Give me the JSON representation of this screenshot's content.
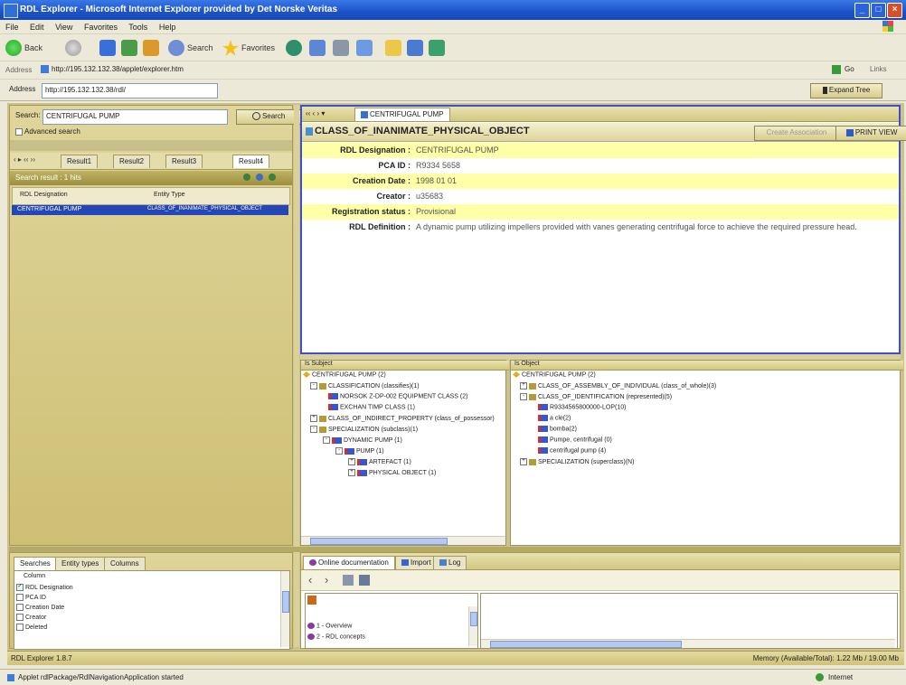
{
  "window": {
    "title": "RDL Explorer - Microsoft Internet Explorer provided by Det Norske Veritas"
  },
  "menu": {
    "items": [
      "File",
      "Edit",
      "View",
      "Favorites",
      "Tools",
      "Help"
    ]
  },
  "toolbar": {
    "back": "Back",
    "search": "Search",
    "favorites": "Favorites"
  },
  "links": {
    "label": "Address",
    "url": "http://195.132.132.38/applet/explorer.htm",
    "go": "Go",
    "links": "Links"
  },
  "address": {
    "label": "Address",
    "value": "http://195.132.132.38/rdl/",
    "button": "Expand Tree"
  },
  "left_panel": {
    "search_label": "Search:",
    "search_value": "CENTRIFUGAL PUMP",
    "search_button": "Search",
    "advanced_search": "Advanced search",
    "result_tabs": [
      "Result1",
      "Result2",
      "Result3",
      "Result4"
    ],
    "result_count": "Search result : 1 hits",
    "columns": [
      "RDL Designation",
      "Entity Type"
    ],
    "rows": [
      {
        "designation": "CENTRIFUGAL PUMP",
        "entity_type": "CLASS_OF_INANIMATE_PHYSICAL_OBJECT"
      }
    ]
  },
  "detail": {
    "tab_label": "CENTRIFUGAL PUMP",
    "class_title": "CLASS_OF_INANIMATE_PHYSICAL_OBJECT",
    "right_button_1": "Create Association",
    "right_button_2": "PRINT VIEW",
    "fields": [
      {
        "key": "RDL Designation :",
        "value": "CENTRIFUGAL PUMP"
      },
      {
        "key": "PCA ID :",
        "value": "R9334 5658"
      },
      {
        "key": "Creation Date :",
        "value": "1998 01 01"
      },
      {
        "key": "Creator :",
        "value": "u35683"
      },
      {
        "key": "Registration status :",
        "value": "Provisional"
      },
      {
        "key": "RDL Definition :",
        "value": "A dynamic pump utilizing impellers provided with vanes generating centrifugal force to achieve the required pressure head."
      }
    ]
  },
  "tree_left": {
    "header": "Is Subject",
    "nodes": [
      "CENTRIFUGAL PUMP (2)",
      "CLASSIFICATION (classifies)(1)",
      "NORSOK Z-DP-002 EQUIPMENT CLASS (2)",
      "EXCHAN TIMP CLASS (1)",
      "CLASS_OF_INDIRECT_PROPERTY (class_of_possessor)",
      "SPECIALIZATION (subclass)(1)",
      "DYNAMIC PUMP (1)",
      "PUMP (1)",
      "ARTEFACT (1)",
      "PHYSICAL OBJECT (1)"
    ]
  },
  "tree_right": {
    "header": "Is Object",
    "nodes": [
      "CENTRIFUGAL PUMP (2)",
      "CLASS_OF_ASSEMBLY_OF_INDIVIDUAL (class_of_whole)(3)",
      "CLASS_OF_IDENTIFICATION (represented)(5)",
      "R9334565800000-LOP(10)",
      "a cle(2)",
      "bomba(2)",
      "Pumpe, centrifugal (0)",
      "centrifugal pump (4)",
      "SPECIALIZATION (superclass)(N)"
    ]
  },
  "bottom_left": {
    "tabs": [
      "Searches",
      "Entity types",
      "Columns"
    ],
    "list_header": "Column",
    "items": [
      "RDL Designation",
      "PCA ID",
      "Creation Date",
      "Creator",
      "Deleted"
    ]
  },
  "bottom_right": {
    "tabs": [
      "Online documentation",
      "Import",
      "Log"
    ],
    "items": [
      "1 - Overview",
      "2 - RDL concepts"
    ]
  },
  "app_status": {
    "left": "RDL Explorer 1.8.7",
    "right": "Memory (Available/Total): 1.22 Mb / 19.00 Mb"
  },
  "ie_status": {
    "left": "Applet rdlPackage/RdlNavigationApplication started",
    "right": "Internet"
  },
  "colors": {
    "accent": "#3a50d0",
    "selection": "#2347b8",
    "highlight": "#ffffa8",
    "olive": "#cdc38a"
  }
}
